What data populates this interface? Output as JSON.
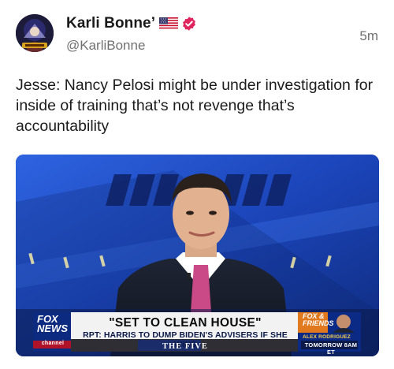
{
  "post": {
    "display_name": "Karli Bonne’",
    "handle": "@KarliBonne",
    "timestamp": "5m",
    "body": "Jesse: Nancy Pelosi might be under investigation for inside of training that’s not revenge that’s accountability",
    "badges": [
      "us-flag-icon",
      "verified-badge-icon"
    ]
  },
  "media": {
    "network": {
      "line1": "FOX",
      "line2": "NEWS",
      "line3": "channel"
    },
    "headline": "\"SET TO CLEAN HOUSE\"",
    "subline": "RPT: HARRIS TO DUMP BIDEN'S ADVISERS IF SHE WINS",
    "show_name": "THE FIVE",
    "promo": {
      "brand_line1": "FOX &",
      "brand_line2": "FRIENDS",
      "host": "ALEX RODRIGUEZ",
      "time": "TOMORROW 8AM ET"
    }
  },
  "colors": {
    "verified": "#e0245e",
    "handle": "#707070",
    "studio_blue": "#1a3a9c",
    "chyron_bar": "#f2f2f2",
    "network_red": "#b0122a"
  }
}
